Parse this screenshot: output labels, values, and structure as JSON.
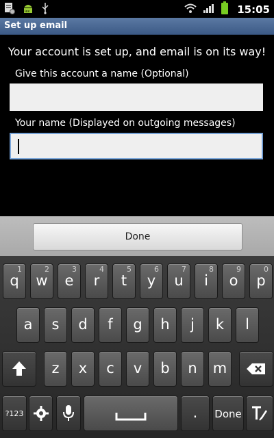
{
  "status": {
    "time": "15:05",
    "left_icons": [
      "notification-doc-icon",
      "android-icon",
      "usb-icon"
    ],
    "right_icons": [
      "wifi-icon",
      "signal-icon",
      "battery-icon"
    ]
  },
  "titlebar": {
    "title": "Set up email"
  },
  "content": {
    "headline": "Your account is set up, and email is on its way!",
    "account_name_label": "Give this account a name (Optional)",
    "account_name_value": "",
    "your_name_label": "Your name (Displayed on outgoing messages)",
    "your_name_value": ""
  },
  "done_bar": {
    "done_label": "Done"
  },
  "keyboard": {
    "row1": [
      {
        "ch": "q",
        "num": "1"
      },
      {
        "ch": "w",
        "num": "2"
      },
      {
        "ch": "e",
        "num": "3"
      },
      {
        "ch": "r",
        "num": "4"
      },
      {
        "ch": "t",
        "num": "5"
      },
      {
        "ch": "y",
        "num": "6"
      },
      {
        "ch": "u",
        "num": "7"
      },
      {
        "ch": "i",
        "num": "8"
      },
      {
        "ch": "o",
        "num": "9"
      },
      {
        "ch": "p",
        "num": "0"
      }
    ],
    "row2": [
      "a",
      "s",
      "d",
      "f",
      "g",
      "h",
      "j",
      "k",
      "l"
    ],
    "row3": [
      "z",
      "x",
      "c",
      "v",
      "b",
      "n",
      "m"
    ],
    "sym_label": "?123",
    "period_label": ".",
    "done_label": "Done",
    "icons": {
      "shift": "shift-arrow-icon",
      "backspace": "backspace-icon",
      "settings": "gear-icon",
      "mic": "microphone-icon",
      "space": "space-bar-icon",
      "text_style": "text-input-icon"
    }
  },
  "colors": {
    "titlebar": "#4a6a96",
    "field_focus_border": "#6e9ad1",
    "keyboard_bg": "#2e2e2e"
  }
}
